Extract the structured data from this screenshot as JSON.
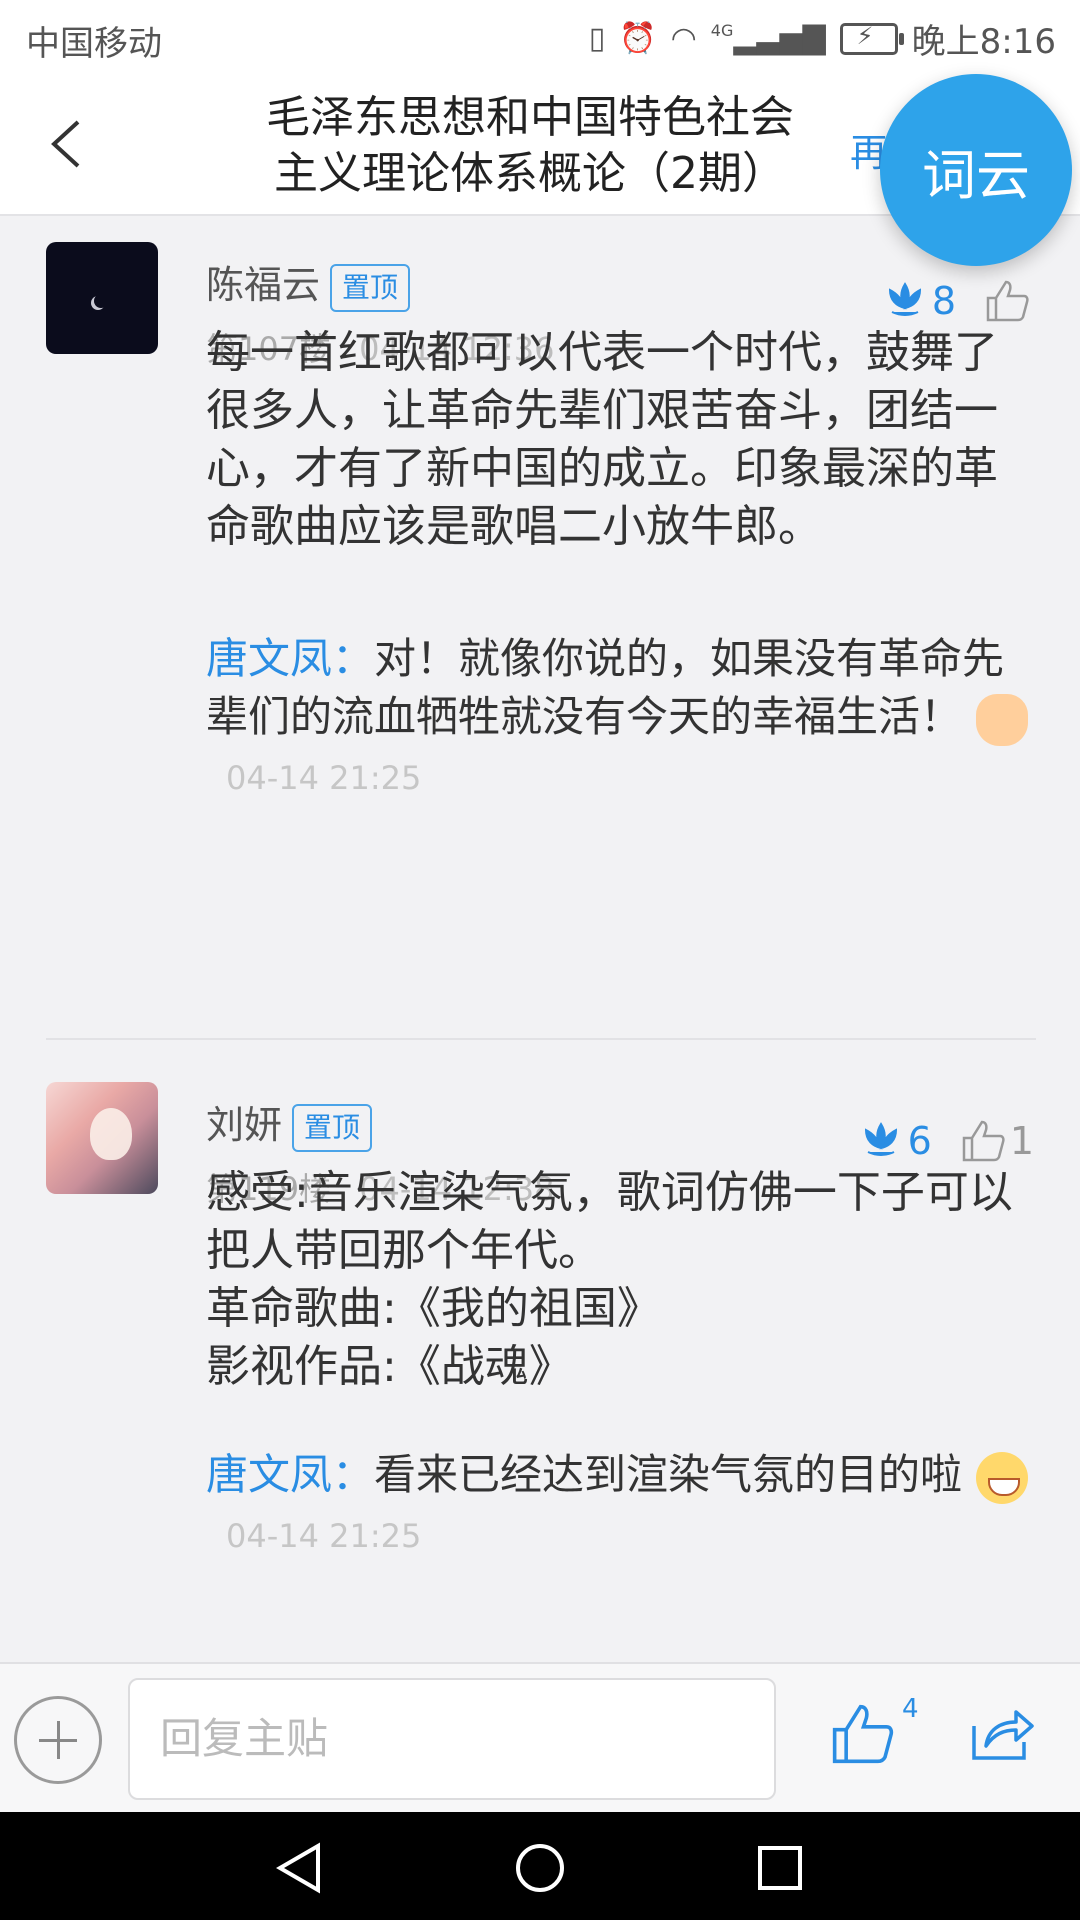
{
  "status_bar": {
    "carrier": "中国移动",
    "signal_label": "4G",
    "time": "晚上8:16"
  },
  "nav": {
    "title_line1": "毛泽东思想和中国特色社会",
    "title_line2": "主义理论体系概论（2期）",
    "more_label": "再",
    "ciyun_label": "词云"
  },
  "posts": [
    {
      "user": "陈福云",
      "badge": "置顶",
      "floor": "第107楼",
      "time": "04-14 12:36",
      "flowers": "8",
      "likes": "",
      "content": "每一首红歌都可以代表一个时代，鼓舞了很多人，让革命先辈们艰苦奋斗，团结一心，才有了新中国的成立。印象最深的革命歌曲应该是歌唱二小放牛郎。",
      "reply": {
        "name": "唐文凤：",
        "text": "对！就像你说的，如果没有革命先辈们的流血牺牲就没有今天的幸福生活！",
        "time": "04-14 21:25"
      }
    },
    {
      "user": "刘妍",
      "badge": "置顶",
      "floor": "第119楼",
      "time": "04-14 12:38",
      "flowers": "6",
      "likes": "1",
      "content_lines": [
        "感受:音乐渲染气氛，歌词仿佛一下子可以把人带回那个年代。",
        "革命歌曲:《我的祖国》",
        "影视作品:《战魂》"
      ],
      "reply": {
        "name": "唐文凤：",
        "text": "看来已经达到渲染气氛的目的啦",
        "time": "04-14 21:25"
      }
    }
  ],
  "bottom_bar": {
    "reply_placeholder": "回复主贴",
    "like_count": "4"
  },
  "icons": [
    "back-arrow-icon",
    "flower-icon",
    "thumb-up-icon",
    "plus-icon",
    "share-icon",
    "nav-back-icon",
    "nav-home-icon",
    "nav-recents-icon"
  ],
  "colors": {
    "accent": "#2a8de3",
    "ciyun_button": "#2ea3ea"
  }
}
